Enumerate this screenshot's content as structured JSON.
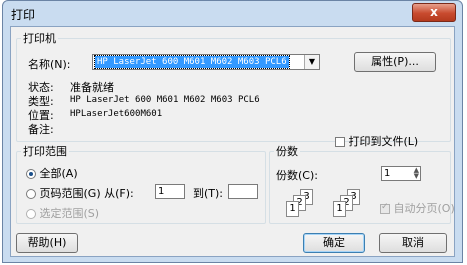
{
  "window": {
    "title": "打印",
    "close_label": "x"
  },
  "printer": {
    "legend": "打印机",
    "name_label": "名称(N):",
    "name_value": "HP LaserJet 600 M601 M602 M603 PCL6",
    "properties_button": "属性(P)...",
    "status_label": "状态:",
    "status_value": "准备就绪",
    "type_label": "类型:",
    "type_value": "HP LaserJet 600 M601 M602 M603 PCL6",
    "location_label": "位置:",
    "location_value": "HPLaserJet600M601",
    "comment_label": "备注:",
    "print_to_file_label": "打印到文件(L)"
  },
  "range": {
    "legend": "打印范围",
    "all_label": "全部(A)",
    "pages_label": "页码范围(G) 从(F):",
    "pages_from": "1",
    "to_label": "到(T):",
    "pages_to": "",
    "selection_label": "选定范围(S)"
  },
  "copies": {
    "legend": "份数",
    "count_label": "份数(C):",
    "count_value": "1",
    "collate_label": "自动分页(O)",
    "page_numbers": [
      "1",
      "2",
      "3"
    ]
  },
  "footer": {
    "help_button": "帮助(H)",
    "ok_button": "确定",
    "cancel_button": "取消"
  }
}
